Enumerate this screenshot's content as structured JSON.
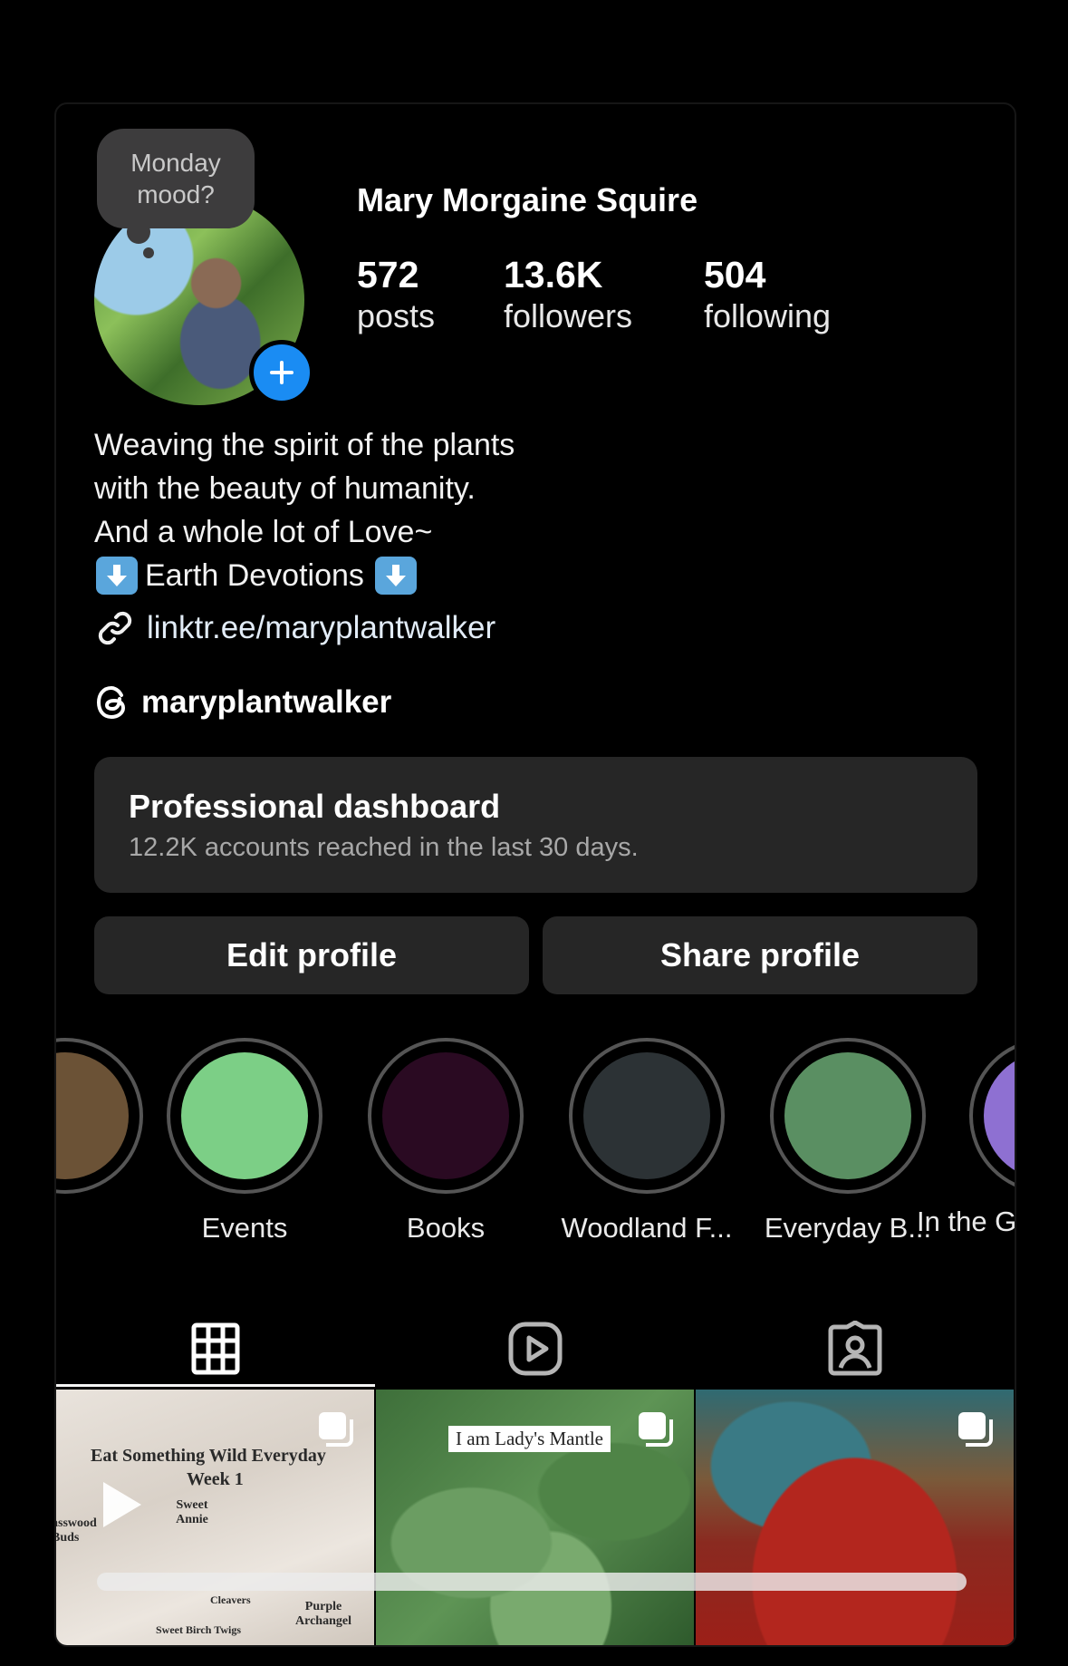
{
  "profile": {
    "note": [
      "Monday",
      "mood?"
    ],
    "name": "Mary Morgaine Squire",
    "stats": [
      {
        "num": "572",
        "label": "posts"
      },
      {
        "num": "13.6K",
        "label": "followers"
      },
      {
        "num": "504",
        "label": "following"
      }
    ],
    "bio": {
      "line1": "Weaving the spirit of the plants",
      "line2": "with the beauty of humanity.",
      "line3": "And a whole lot of Love~",
      "line4": "Earth Devotions"
    },
    "link": "linktr.ee/maryplantwalker",
    "threads_handle": "maryplantwalker"
  },
  "dashboard": {
    "title": "Professional dashboard",
    "subtitle": "12.2K accounts reached in the last 30 days."
  },
  "buttons": {
    "edit": "Edit profile",
    "share": "Share profile"
  },
  "highlights": [
    {
      "label": "Events",
      "color": "#7ccf86"
    },
    {
      "label": "Books",
      "color": "#2a0a22"
    },
    {
      "label": "Woodland F...",
      "color": "#2c3235"
    },
    {
      "label": "Everyday B...",
      "color": "#5a8f62"
    },
    {
      "label": "In the G",
      "color": "#8e70d2"
    }
  ],
  "tabs": [
    "grid-icon",
    "reels-icon",
    "tagged-icon"
  ],
  "posts": {
    "post1": {
      "title": "Eat Something Wild Everyday",
      "week": "Week 1",
      "labels": [
        "Sweet Annie",
        "asswood Buds",
        "Cleavers",
        "Purple Archangel",
        "Sweet Birch Twigs"
      ]
    },
    "post2": {
      "label": "I am Lady's Mantle"
    }
  }
}
